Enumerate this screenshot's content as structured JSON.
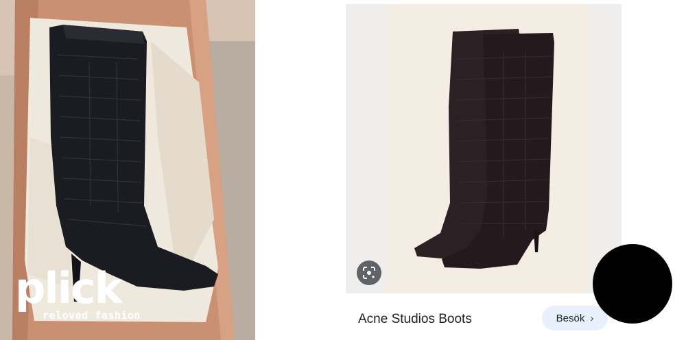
{
  "left_photo": {
    "brand_name": "plick",
    "brand_tagline": "reloved fashion"
  },
  "product_card": {
    "title": "Acne Studios Boots",
    "visit_button_label": "Besök",
    "lens_icon": "google-lens-icon"
  },
  "colors": {
    "box": "#c99072",
    "boot": "#1a1a1f",
    "image_bg": "#efeeec",
    "visit_button_bg": "#e8f0fe"
  }
}
